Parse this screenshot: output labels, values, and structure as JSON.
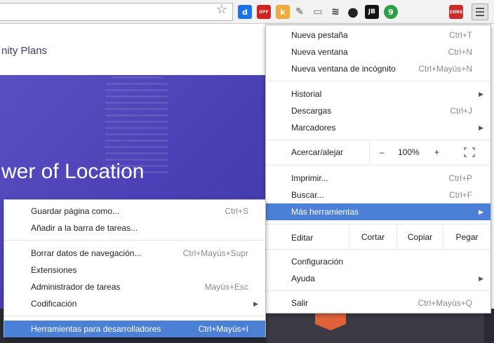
{
  "toolbar": {
    "extensions": [
      {
        "name": "dashlane-icon",
        "glyph": "d",
        "color": "#1a73e8"
      },
      {
        "name": "cookie-off-icon",
        "glyph": "OFF",
        "color": "#d32222"
      },
      {
        "name": "k-extension-icon",
        "glyph": "k",
        "color": "#f2a93b"
      },
      {
        "name": "pencil-icon",
        "glyph": "✎",
        "color": "#555555"
      },
      {
        "name": "cast-icon",
        "glyph": "▭",
        "color": "#666666"
      },
      {
        "name": "layers-icon",
        "glyph": "≋",
        "color": "#333333"
      },
      {
        "name": "color-picker-icon",
        "glyph": "●",
        "color": "#222222"
      },
      {
        "name": "jb-icon",
        "glyph": "JB",
        "color": "#111111"
      },
      {
        "name": "evernote-icon",
        "glyph": "9",
        "color": "#2e9f45"
      },
      {
        "name": "cors-icon",
        "glyph": "CORS",
        "color": "#cc2b2b"
      }
    ]
  },
  "page": {
    "nav_text": "nity  Plans",
    "hero_title": "wer of Location"
  },
  "menu": {
    "items": [
      {
        "label": "Nueva pestaña",
        "shortcut": "Ctrl+T"
      },
      {
        "label": "Nueva ventana",
        "shortcut": "Ctrl+N"
      },
      {
        "label": "Nueva ventana de incógnito",
        "shortcut": "Ctrl+Mayús+N"
      },
      {
        "label": "Historial",
        "shortcut": ""
      },
      {
        "label": "Descargas",
        "shortcut": "Ctrl+J"
      },
      {
        "label": "Marcadores",
        "shortcut": ""
      },
      {
        "label": "Imprimir...",
        "shortcut": "Ctrl+P"
      },
      {
        "label": "Buscar...",
        "shortcut": "Ctrl+F"
      },
      {
        "label": "Más herramientas",
        "shortcut": ""
      },
      {
        "label": "Configuración",
        "shortcut": ""
      },
      {
        "label": "Ayuda",
        "shortcut": ""
      },
      {
        "label": "Salir",
        "shortcut": "Ctrl+Mayús+Q"
      }
    ],
    "zoom": {
      "label": "Acercar/alejar",
      "minus": "–",
      "value": "100%",
      "plus": "+"
    },
    "edit": {
      "label": "Editar",
      "cut": "Cortar",
      "copy": "Copiar",
      "paste": "Pegar"
    }
  },
  "submenu": {
    "items": [
      {
        "label": "Guardar página como...",
        "shortcut": "Ctrl+S"
      },
      {
        "label": "Añadir a la barra de tareas...",
        "shortcut": ""
      },
      {
        "label": "Borrar datos de navegación...",
        "shortcut": "Ctrl+Mayús+Supr"
      },
      {
        "label": "Extensiones",
        "shortcut": ""
      },
      {
        "label": "Administrador de tareas",
        "shortcut": "Mayús+Esc"
      },
      {
        "label": "Codificación",
        "shortcut": ""
      },
      {
        "label": "Herramientas para desarrolladores",
        "shortcut": "Ctrl+Mayús+I"
      }
    ]
  },
  "colors": {
    "highlight": "#4c7fd6",
    "hero": "#4a3fb4"
  }
}
